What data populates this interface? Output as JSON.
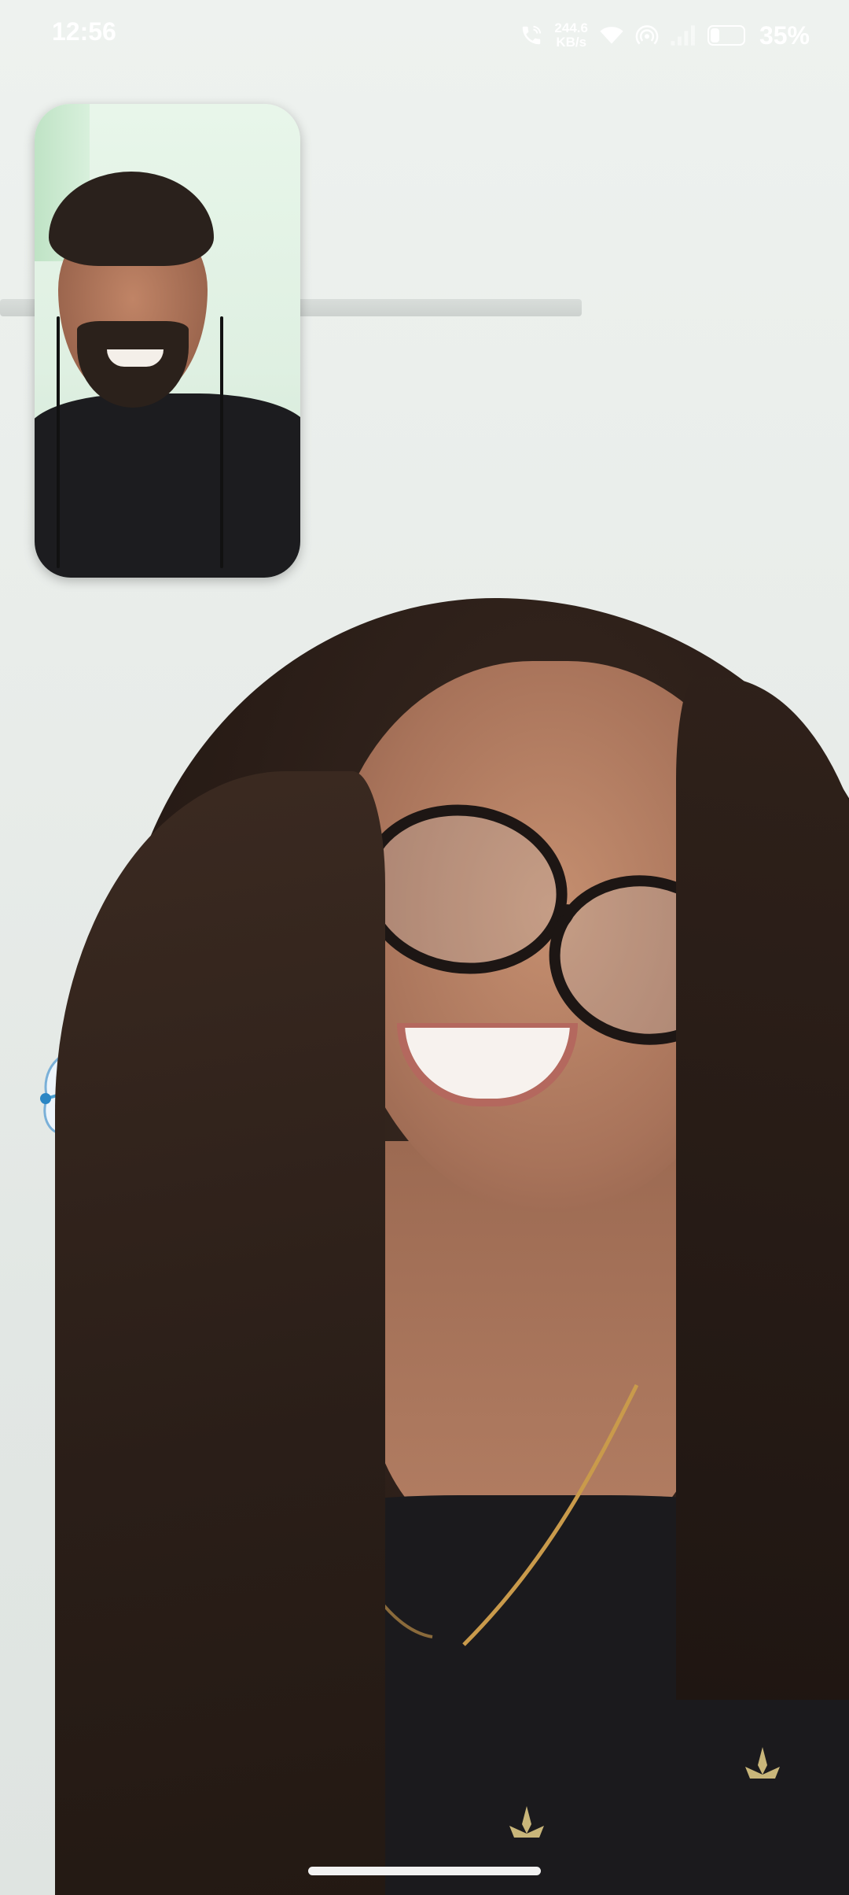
{
  "status_bar": {
    "time": "12:56",
    "net_speed_value": "244.6",
    "net_speed_unit": "KB/s",
    "battery_percent": "35%",
    "battery_level": 0.35,
    "icons": [
      "wifi-calling-icon",
      "wifi-icon",
      "hotspot-icon",
      "signal-icon",
      "battery-icon"
    ]
  },
  "call": {
    "remote_video": "remote-participant-video",
    "self_preview": "self-preview-video"
  },
  "colors": {
    "status_text": "#ffffff",
    "home_indicator": "#f2f2f2"
  }
}
